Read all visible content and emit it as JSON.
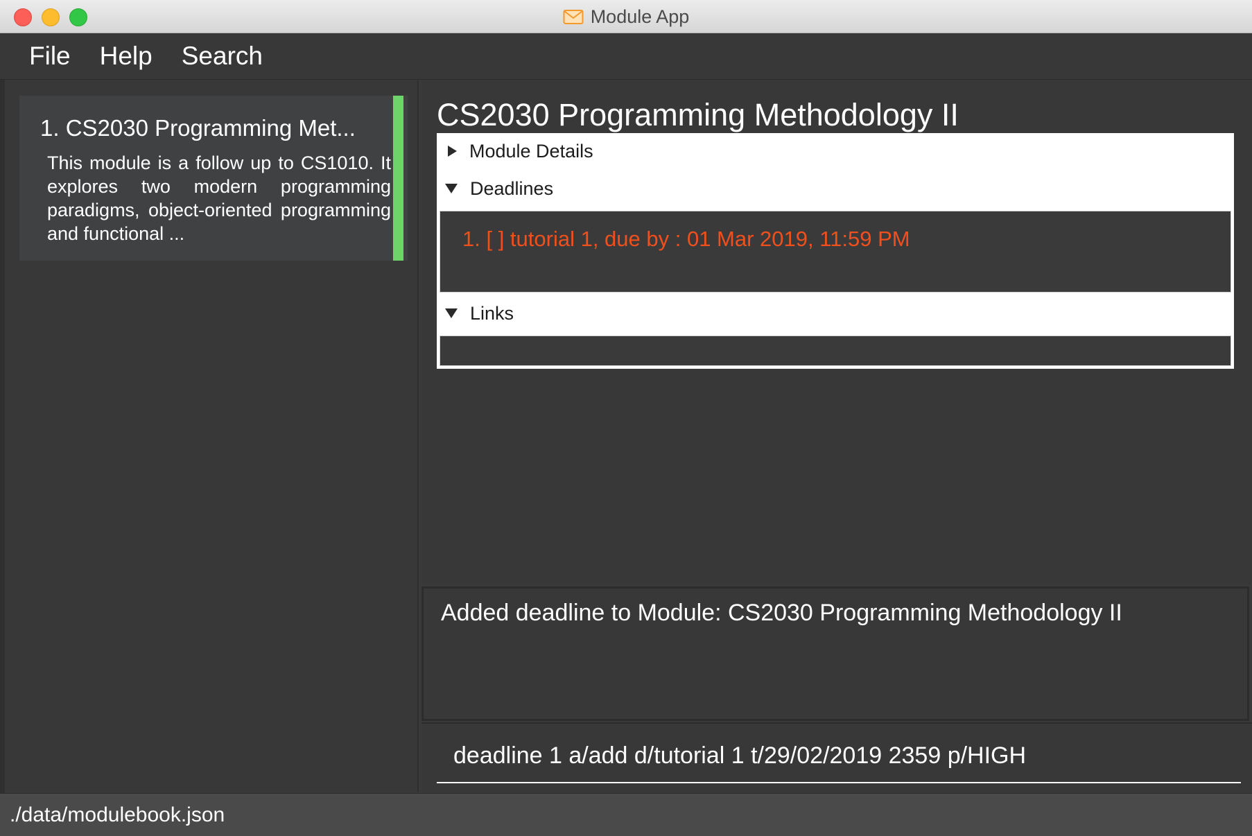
{
  "window": {
    "title": "Module App",
    "icon": "envelope-icon"
  },
  "menu": {
    "items": [
      "File",
      "Help",
      "Search"
    ]
  },
  "module_list": {
    "cards": [
      {
        "title": "1.  CS2030 Programming Met...",
        "description": "This module is a follow up to CS1010. It explores two modern programming paradigms, object-oriented programming and functional ...",
        "accent_color": "#6ed36a"
      }
    ]
  },
  "module_view": {
    "title": "CS2030 Programming Methodology II",
    "sections": {
      "module_details": "Module Details",
      "deadlines": "Deadlines",
      "links": "Links"
    },
    "deadlines": [
      "1. [ ] tutorial 1, due by : 01 Mar 2019, 11:59 PM"
    ],
    "deadline_color": "#f1501d"
  },
  "result": {
    "message": "Added deadline to Module: CS2030 Programming Methodology II"
  },
  "command": {
    "value": "deadline 1 a/add d/tutorial 1 t/29/02/2019 2359 p/HIGH"
  },
  "status": {
    "path": "./data/modulebook.json"
  }
}
